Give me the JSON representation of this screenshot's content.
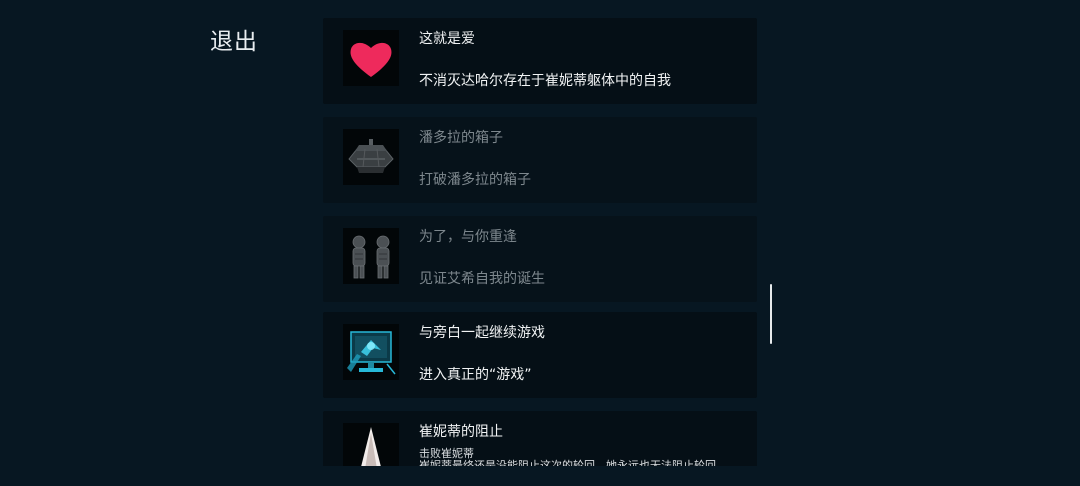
{
  "header": {
    "exit_label": "退出"
  },
  "achievements": [
    {
      "title": "这就是爱",
      "description": "不消灭达哈尔存在于崔妮蒂躯体中的自我",
      "icon": "heart-icon",
      "unlocked": true
    },
    {
      "title": "潘多拉的箱子",
      "description": "打破潘多拉的箱子",
      "icon": "pandora-box-icon",
      "unlocked": false
    },
    {
      "title": "为了，与你重逢",
      "description": "见证艾希自我的诞生",
      "icon": "twin-figures-icon",
      "unlocked": false
    },
    {
      "title": "与旁白一起继续游戏",
      "description": "进入真正的“游戏”",
      "icon": "monitor-icon",
      "unlocked": true
    },
    {
      "title": "崔妮蒂的阻止",
      "description_line1": "击败崔妮蒂",
      "description_line2": "崔妮蒂最终还是没能阻止这次的轮回，她永远也无法阻止轮回",
      "icon": "spire-icon",
      "unlocked": true
    }
  ],
  "colors": {
    "background": "#071722",
    "card": "#050f16",
    "heart": "#ee2a5c",
    "monitor_glow": "#27b8d8",
    "locked_text": "#7d878d"
  }
}
